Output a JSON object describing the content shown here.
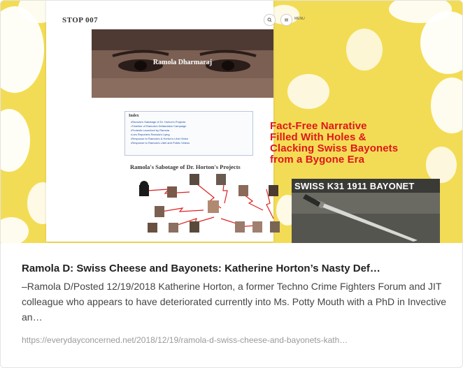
{
  "thumbnail": {
    "site_brand": "STOP 007",
    "search_icon": "search-icon",
    "menu_icon": "menu-icon",
    "menu_label": "MENU",
    "hero_name": "Ramola Dharmaraj",
    "index_title": "Index",
    "index_items": [
      "Ramola's Sabotage of Dr. Horton's Projects",
      "Timeline of Ramola's Defamation Campaign",
      "Protests Launched by Ramola",
      "Lies Reporters Ramola's Lying",
      "Response to Ramola's & Horton's Libel Video",
      "Response to Ramola's Libel and Public Videos"
    ],
    "section_heading": "Ramola's Sabotage of Dr. Horton's Projects",
    "overlay_lines": [
      "Fact-Free Narrative",
      "Filled With Holes &",
      "Clacking Swiss Bayonets",
      "from a Bygone Era"
    ],
    "bayonet_caption": "SWISS K31 1911 BAYONET",
    "colors": {
      "background_yellow": "#f3dc55",
      "overlay_red": "#e0161b",
      "link_blue": "#2050a8"
    }
  },
  "card": {
    "title": "Ramola D: Swiss Cheese and Bayonets: Katherine Horton’s Nasty Def…",
    "description": "–Ramola D/Posted 12/19/2018 Katherine Horton, a former Techno Crime Fighters Forum and JIT colleague who appears to have deteriorated currently into Ms. Potty Mouth with a PhD in Invective an…",
    "url": "https://everydayconcerned.net/2018/12/19/ramola-d-swiss-cheese-and-bayonets-kath…"
  }
}
